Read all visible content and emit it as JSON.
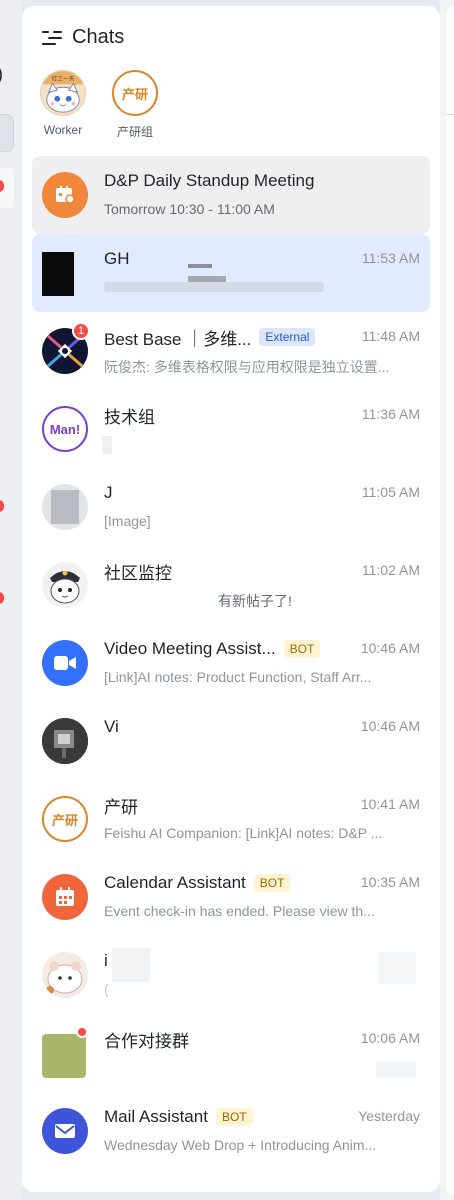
{
  "header": {
    "title": "Chats",
    "menu_icon": "collapse-menu-icon"
  },
  "pinned": [
    {
      "label": "Worker",
      "avatar": "cat-cartoon"
    },
    {
      "label": "产研组",
      "avatar_text": "产研"
    }
  ],
  "chats": [
    {
      "name": "D&P Daily Standup Meeting",
      "preview": "Tomorrow 10:30 - 11:00 AM",
      "time": "",
      "avatar_icon": "calendar-bell-icon",
      "highlight": "gray"
    },
    {
      "name": "GH",
      "preview": "",
      "time": "11:53 AM",
      "highlight": "blue"
    },
    {
      "name": "Best Base ｜多维...",
      "tag": "External",
      "preview": "阮俊杰: 多维表格权限与应用权限是独立设置...",
      "time": "11:48 AM",
      "badge": "1"
    },
    {
      "name": "技术组",
      "preview": "",
      "time": "11:36 AM",
      "avatar_text": "Man!"
    },
    {
      "name": "J",
      "preview": "[Image]",
      "time": "11:05 AM"
    },
    {
      "name": "社区监控",
      "preview": "有新帖子了!",
      "time": "11:02 AM"
    },
    {
      "name": "Video Meeting Assist...",
      "tag": "BOT",
      "preview": "[Link]AI notes: Product Function, Staff Arr...",
      "time": "10:46 AM",
      "avatar_icon": "video-camera-icon"
    },
    {
      "name": "Vi",
      "preview": "",
      "time": "10:46 AM"
    },
    {
      "name": "产研",
      "preview": "Feishu AI Companion: [Link]AI notes: D&P ...",
      "time": "10:41 AM",
      "avatar_text": "产研"
    },
    {
      "name": "Calendar Assistant",
      "tag": "BOT",
      "preview": "Event check-in has ended. Please view th...",
      "time": "10:35 AM",
      "avatar_icon": "calendar-icon"
    },
    {
      "name": "i",
      "preview": "(",
      "time": ""
    },
    {
      "name": "合作对接群",
      "preview": "",
      "time": "10:06 AM"
    },
    {
      "name": "Mail Assistant",
      "tag": "BOT",
      "preview": "Wednesday Web Drop + Introducing Anim...",
      "time": "Yesterday",
      "avatar_icon": "mail-icon"
    }
  ],
  "colors": {
    "accent_blue": "#3370ff",
    "badge_red": "#f54a45",
    "orange": "#f07e3a",
    "purple": "#7f3bf5",
    "bot_tag_bg": "#fff3d1",
    "external_tag_bg": "#dce7ff"
  }
}
